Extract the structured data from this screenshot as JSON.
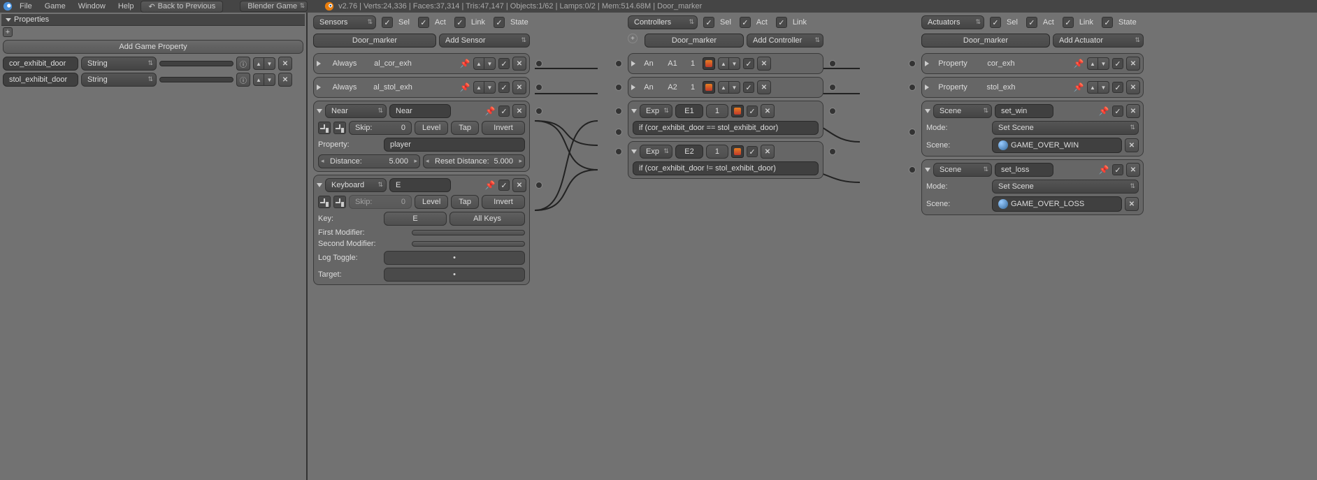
{
  "menu": {
    "file": "File",
    "game": "Game",
    "window": "Window",
    "help": "Help",
    "back": "Back to Previous",
    "engine": "Blender Game",
    "stats": "v2.76 | Verts:24,336 | Faces:37,314 | Tris:47,147 | Objects:1/62 | Lamps:0/2 | Mem:514.68M | Door_marker"
  },
  "sidebar": {
    "title": "Properties",
    "add_prop": "Add Game Property",
    "props": [
      {
        "name": "cor_exhibit_door",
        "type": "String",
        "value": ""
      },
      {
        "name": "stol_exhibit_door",
        "type": "String",
        "value": ""
      }
    ]
  },
  "filters": {
    "sensors": "Sensors",
    "controllers": "Controllers",
    "actuators": "Actuators",
    "sel": "Sel",
    "act": "Act",
    "link": "Link",
    "state": "State"
  },
  "obj": {
    "name": "Door_marker",
    "add_sensor": "Add Sensor",
    "add_controller": "Add Controller",
    "add_actuator": "Add Actuator"
  },
  "sensors": {
    "s0": {
      "type": "Always",
      "name": "al_cor_exh"
    },
    "s1": {
      "type": "Always",
      "name": "al_stol_exh"
    },
    "s2": {
      "type": "Near",
      "name": "Near",
      "skip": "Skip:",
      "skipval": "0",
      "level": "Level",
      "tap": "Tap",
      "invert": "Invert",
      "prop_l": "Property:",
      "prop_v": "player",
      "dist_l": "Distance:",
      "dist_v": "5.000",
      "rdist_l": "Reset Distance:",
      "rdist_v": "5.000"
    },
    "s3": {
      "type": "Keyboard",
      "name": "E",
      "skip": "Skip:",
      "skipval": "0",
      "level": "Level",
      "tap": "Tap",
      "invert": "Invert",
      "key_l": "Key:",
      "key_v": "E",
      "allkeys": "All Keys",
      "fm_l": "First Modifier:",
      "sm_l": "Second Modifier:",
      "log_l": "Log Toggle:",
      "tgt_l": "Target:"
    }
  },
  "controllers": {
    "c0": {
      "type": "An",
      "name": "A1",
      "n": "1"
    },
    "c1": {
      "type": "An",
      "name": "A2",
      "n": "1"
    },
    "c2": {
      "type": "Exp",
      "name": "E1",
      "n": "1",
      "expr": "if (cor_exhibit_door == stol_exhibit_door)"
    },
    "c3": {
      "type": "Exp",
      "name": "E2",
      "n": "1",
      "expr": "if (cor_exhibit_door != stol_exhibit_door)"
    }
  },
  "actuators": {
    "a0": {
      "type": "Property",
      "name": "cor_exh"
    },
    "a1": {
      "type": "Property",
      "name": "stol_exh"
    },
    "a2": {
      "type": "Scene",
      "name": "set_win",
      "mode_l": "Mode:",
      "mode_v": "Set Scene",
      "scene_l": "Scene:",
      "scene_v": "GAME_OVER_WIN"
    },
    "a3": {
      "type": "Scene",
      "name": "set_loss",
      "mode_l": "Mode:",
      "mode_v": "Set Scene",
      "scene_l": "Scene:",
      "scene_v": "GAME_OVER_LOSS"
    }
  }
}
